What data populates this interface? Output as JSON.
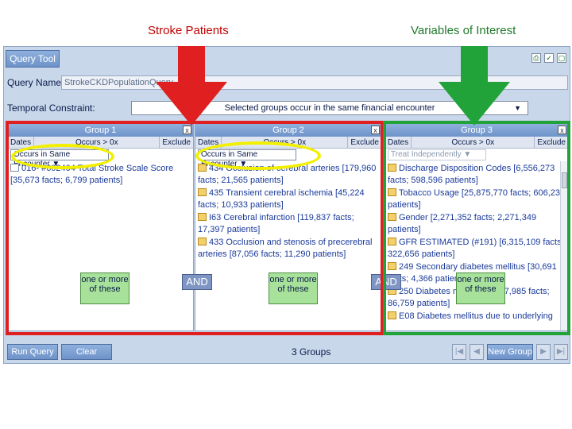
{
  "annotations": {
    "left_label": "Stroke Patients",
    "right_label": "Variables of Interest"
  },
  "app": {
    "title_tab": "Query Tool",
    "query_name_label": "Query Name:",
    "query_name_value": "StrokeCKDPopulationQuery",
    "temporal_label": "Temporal Constraint:",
    "temporal_value": "Selected groups occur in the same financial encounter"
  },
  "groups": [
    {
      "title": "Group 1",
      "col_dates": "Dates",
      "col_occurs": "Occurs > 0x",
      "col_exclude": "Exclude",
      "select": "Occurs in Same Encounter",
      "items": [
        "016- #602404 Total Stroke Scale Score [35,673 facts; 6,799 patients]"
      ],
      "one_or_label": "one or more of these"
    },
    {
      "title": "Group 2",
      "col_dates": "Dates",
      "col_occurs": "Occurs > 0x",
      "col_exclude": "Exclude",
      "select": "Occurs in Same Encounter",
      "items": [
        "434 Occlusion of cerebral arteries [179,960 facts; 21,565 patients]",
        "435 Transient cerebral ischemia [45,224 facts; 10,933 patients]",
        "I63 Cerebral infarction [119,837 facts; 17,397 patients]",
        "433 Occlusion and stenosis of precerebral arteries [87,056 facts; 11,290 patients]"
      ],
      "one_or_label": "one or more of these"
    },
    {
      "title": "Group 3",
      "col_dates": "Dates",
      "col_occurs": "Occurs > 0x",
      "col_exclude": "Exclude",
      "select": "Treat Independently",
      "items": [
        "Discharge Disposition Codes [6,556,273 facts; 598,596 patients]",
        "Tobacco Usage [25,875,770 facts; 606,232 patients]",
        "Gender [2,271,352 facts; 2,271,349 patients]",
        "GFR ESTIMATED (#191) [6,315,109 facts; 322,656 patients]",
        "249 Secondary diabetes mellitus [30,691 facts; 4,366 patients]",
        "250 Diabetes mellitus [4,457,985 facts; 86,759 patients]",
        "E08 Diabetes mellitus due to underlying"
      ],
      "one_or_label": "one or more of these"
    }
  ],
  "and_label": "AND",
  "bottom": {
    "run_query": "Run Query",
    "clear": "Clear",
    "groups_count": "3 Groups",
    "new_group": "New Group"
  },
  "colors": {
    "red_highlight": "#e02020",
    "green_highlight": "#22a33a",
    "yellow_highlight": "#f2f000",
    "header_blue": "#6e93c9"
  }
}
